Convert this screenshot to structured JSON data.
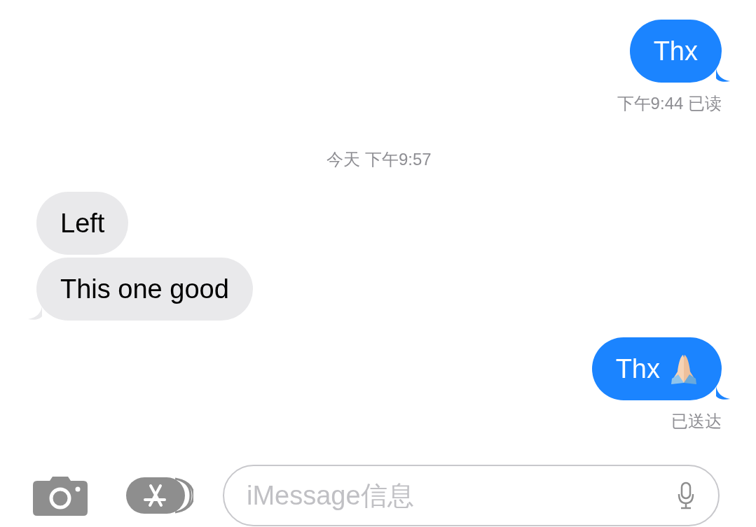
{
  "messages": [
    {
      "kind": "sent",
      "text": "Thx",
      "tail": true,
      "emoji": false
    },
    {
      "kind": "status",
      "text": "下午9:44 已读"
    },
    {
      "kind": "timestamp",
      "text": "今天 下午9:57"
    },
    {
      "kind": "received",
      "text": "Left",
      "tail": false
    },
    {
      "kind": "received",
      "text": "This one good",
      "tail": true
    },
    {
      "kind": "sent",
      "text": "Thx",
      "tail": true,
      "emoji": true
    },
    {
      "kind": "status",
      "text": "已送达"
    }
  ],
  "composer": {
    "placeholder": "iMessage信息"
  }
}
